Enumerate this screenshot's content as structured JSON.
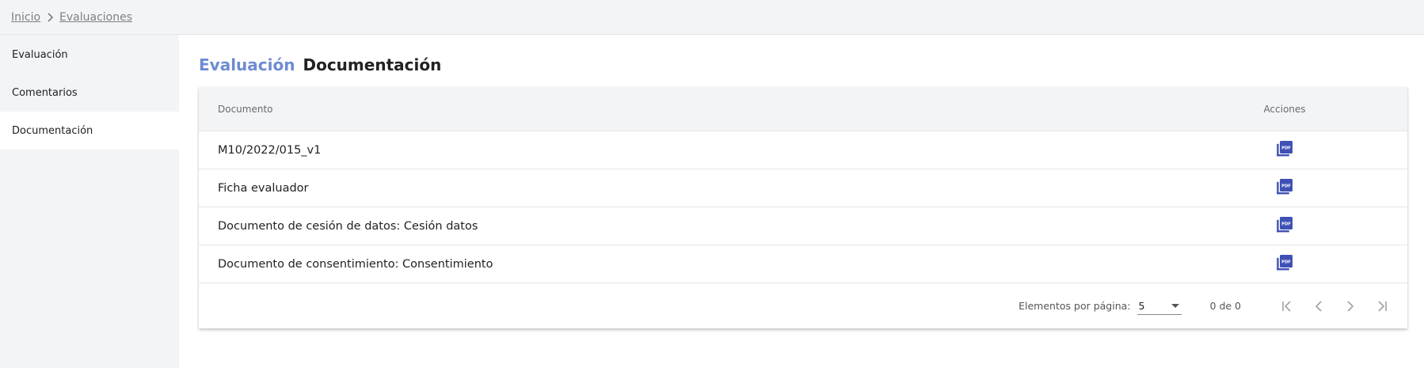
{
  "breadcrumb": {
    "home": "Inicio",
    "current": "Evaluaciones"
  },
  "sidebar": {
    "items": [
      {
        "label": "Evaluación"
      },
      {
        "label": "Comentarios"
      },
      {
        "label": "Documentación",
        "active": true
      }
    ]
  },
  "page": {
    "title_prefix": "Evaluación",
    "title": "Documentación"
  },
  "table": {
    "columns": {
      "document": "Documento",
      "actions": "Acciones"
    },
    "rows": [
      {
        "document": "M10/2022/015_v1",
        "action_icon": "pdf-icon"
      },
      {
        "document": "Ficha evaluador",
        "action_icon": "pdf-icon"
      },
      {
        "document": "Documento de cesión de datos: Cesión datos",
        "action_icon": "pdf-icon"
      },
      {
        "document": "Documento de consentimiento: Consentimiento",
        "action_icon": "pdf-icon"
      }
    ]
  },
  "paginator": {
    "items_label": "Elementos por página:",
    "page_size": "5",
    "range_label": "0 de 0"
  },
  "colors": {
    "accent": "#6e8bd2",
    "pdf_icon": "#3f51b5",
    "sidebar_bg": "#f2f4f6"
  }
}
